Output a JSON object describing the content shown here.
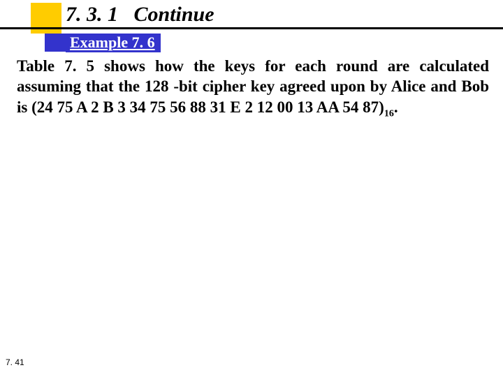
{
  "heading": {
    "number": "7. 3. 1",
    "title": "Continue"
  },
  "example": {
    "label": "Example 7. 6"
  },
  "body": {
    "text": "Table 7. 5 shows how the keys for each round are calculated assuming that the 128 -bit cipher key agreed upon by Alice and Bob is (24 75 A 2 B 3 34 75 56 88 31 E 2 12 00 13 AA 54 87)",
    "subscript": "16",
    "tail": "."
  },
  "page": {
    "number": "7. 41"
  }
}
